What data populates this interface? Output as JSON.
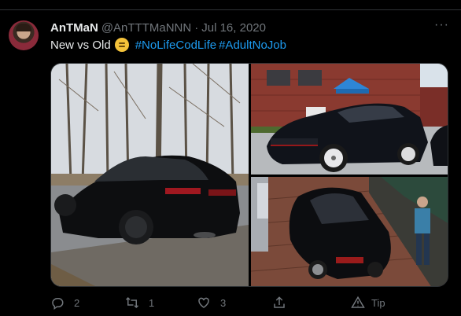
{
  "tweet": {
    "author_name": "AnTMaN",
    "author_handle": "@AnTTTMaNNN",
    "separator": "·",
    "date": "Jul 16, 2020",
    "more_label": "···",
    "text": "New vs Old",
    "emoji": "thinking-face",
    "hashtags": [
      "#NoLifeCodLife",
      "#AdultNoJob"
    ]
  },
  "media": {
    "photos": [
      "black-bmw-coupe-in-woods",
      "dark-vw-golf-gti-parked",
      "dark-vw-golf-on-brick-driveway"
    ]
  },
  "actions": {
    "reply_count": "2",
    "retweet_count": "1",
    "like_count": "3",
    "tip_label": "Tip"
  },
  "colors": {
    "background": "#000000",
    "text": "#e7e9ea",
    "muted": "#71767b",
    "link": "#1d9bf0",
    "border": "#2f3336"
  }
}
